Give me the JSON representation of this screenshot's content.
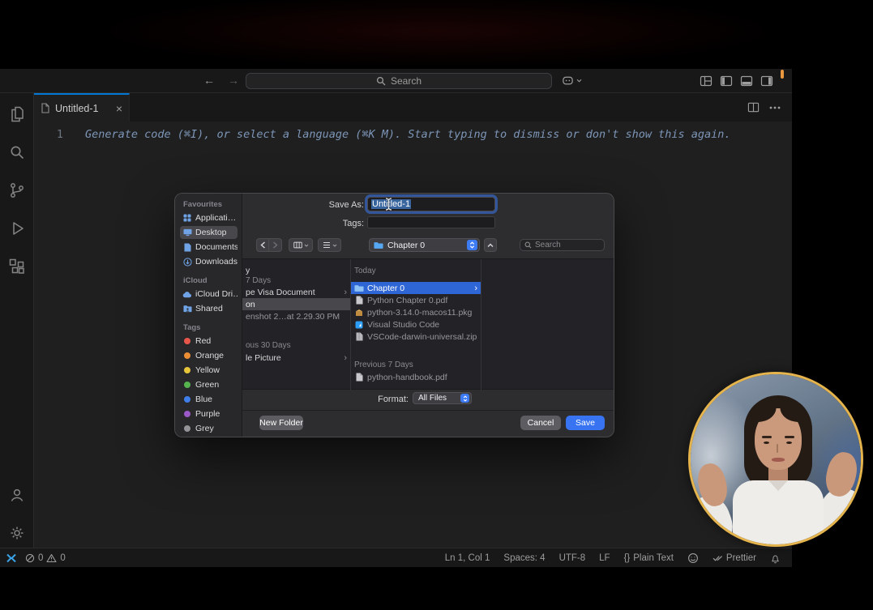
{
  "colors": {
    "active_tab_indicator": "#0078d4",
    "selection_blue": "#2f66d6",
    "save_button_blue": "#3874f2",
    "webcam_ring": "#e6b44c"
  },
  "window": {
    "titlebar": {
      "search_placeholder": "Search"
    },
    "tab": {
      "label": "Untitled-1"
    },
    "editor": {
      "line_number": "1",
      "ghost_text": "Generate code (⌘I), or select a language (⌘K M). Start typing to dismiss or don't show this again."
    },
    "statusbar": {
      "errors": "0",
      "warnings": "0",
      "cursor": "Ln 1, Col 1",
      "indent": "Spaces: 4",
      "encoding": "UTF-8",
      "eol": "LF",
      "lang_glyph": "{}",
      "language": "Plain Text",
      "formatter": "Prettier"
    }
  },
  "dialog": {
    "save_as_label": "Save As:",
    "save_as_value": "Untitled-1",
    "tags_label": "Tags:",
    "location_value": "Chapter 0",
    "search_placeholder": "Search",
    "sidebar": {
      "favourites_title": "Favourites",
      "favourites": [
        "Applicati…",
        "Desktop",
        "Documents",
        "Downloads"
      ],
      "icloud_title": "iCloud",
      "icloud": [
        "iCloud Dri…",
        "Shared"
      ],
      "tags_title": "Tags",
      "tags": [
        {
          "label": "Red",
          "color": "#e8564a"
        },
        {
          "label": "Orange",
          "color": "#eb8d33"
        },
        {
          "label": "Yellow",
          "color": "#e7c53b"
        },
        {
          "label": "Green",
          "color": "#55b44e"
        },
        {
          "label": "Blue",
          "color": "#3f7ee8"
        },
        {
          "label": "Purple",
          "color": "#9b59c8"
        },
        {
          "label": "Grey",
          "color": "#949498"
        }
      ]
    },
    "middle_column": [
      {
        "label": "y"
      },
      {
        "label": "7 Days"
      },
      {
        "label": "pe Visa Document"
      },
      {
        "label": "on"
      },
      {
        "label": "enshot 2…at 2.29.30 PM"
      },
      {
        "label": "ous 30 Days"
      },
      {
        "label": "le Picture"
      }
    ],
    "file_column": {
      "group1_header": "Today",
      "group1": [
        {
          "label": "Chapter 0"
        },
        {
          "label": "Python Chapter 0.pdf"
        },
        {
          "label": "python-3.14.0-macos11.pkg"
        },
        {
          "label": "Visual Studio Code"
        },
        {
          "label": "VSCode-darwin-universal.zip"
        }
      ],
      "group2_header": "Previous 7 Days",
      "group2": [
        {
          "label": "python-handbook.pdf"
        }
      ]
    },
    "format_label": "Format:",
    "format_value": "All Files",
    "new_folder_button": "New Folder",
    "cancel_button": "Cancel",
    "save_button": "Save"
  }
}
